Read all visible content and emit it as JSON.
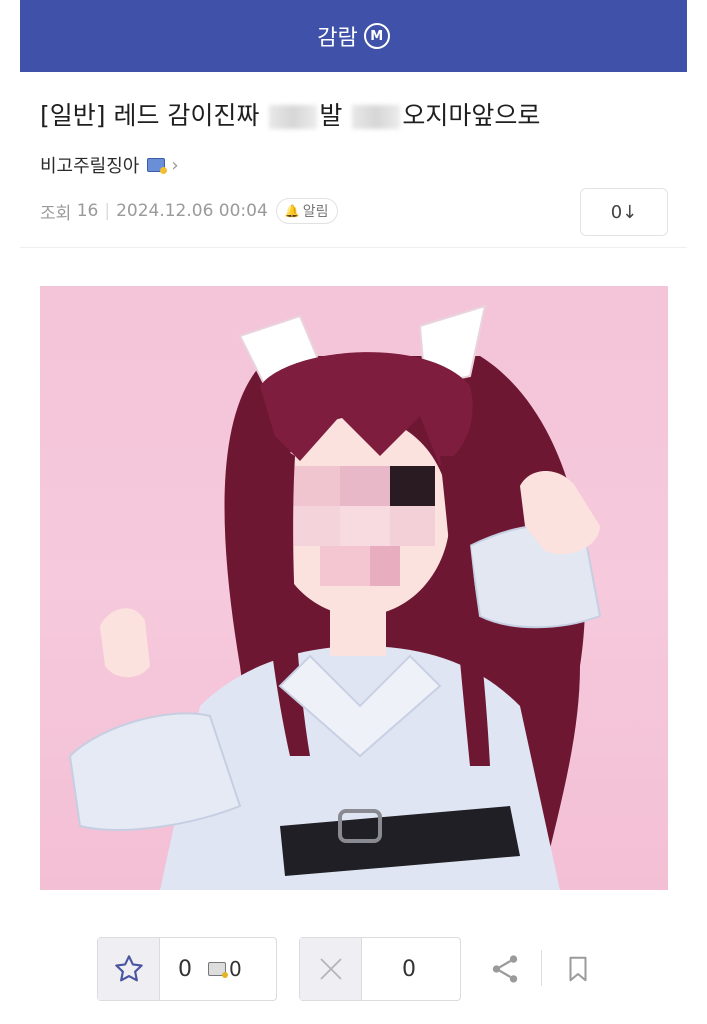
{
  "header": {
    "title": "감람",
    "badge": "M"
  },
  "post": {
    "title_prefix": "[일반] 레드 감이진짜",
    "title_mid": "발 ",
    "title_suffix": "오지마앞으로",
    "author": "비고주릴징아",
    "views_label": "조회",
    "views": "16",
    "datetime": "2024.12.06 00:04",
    "alert_label": "알림",
    "comment_count": "0↓"
  },
  "actions": {
    "upvotes": "0",
    "upvote_badge_count": "0",
    "downvotes": "0"
  },
  "colors": {
    "header_bg": "#3f51a8",
    "image_bg": "#f4c4d8",
    "hair": "#7a1a3a"
  }
}
